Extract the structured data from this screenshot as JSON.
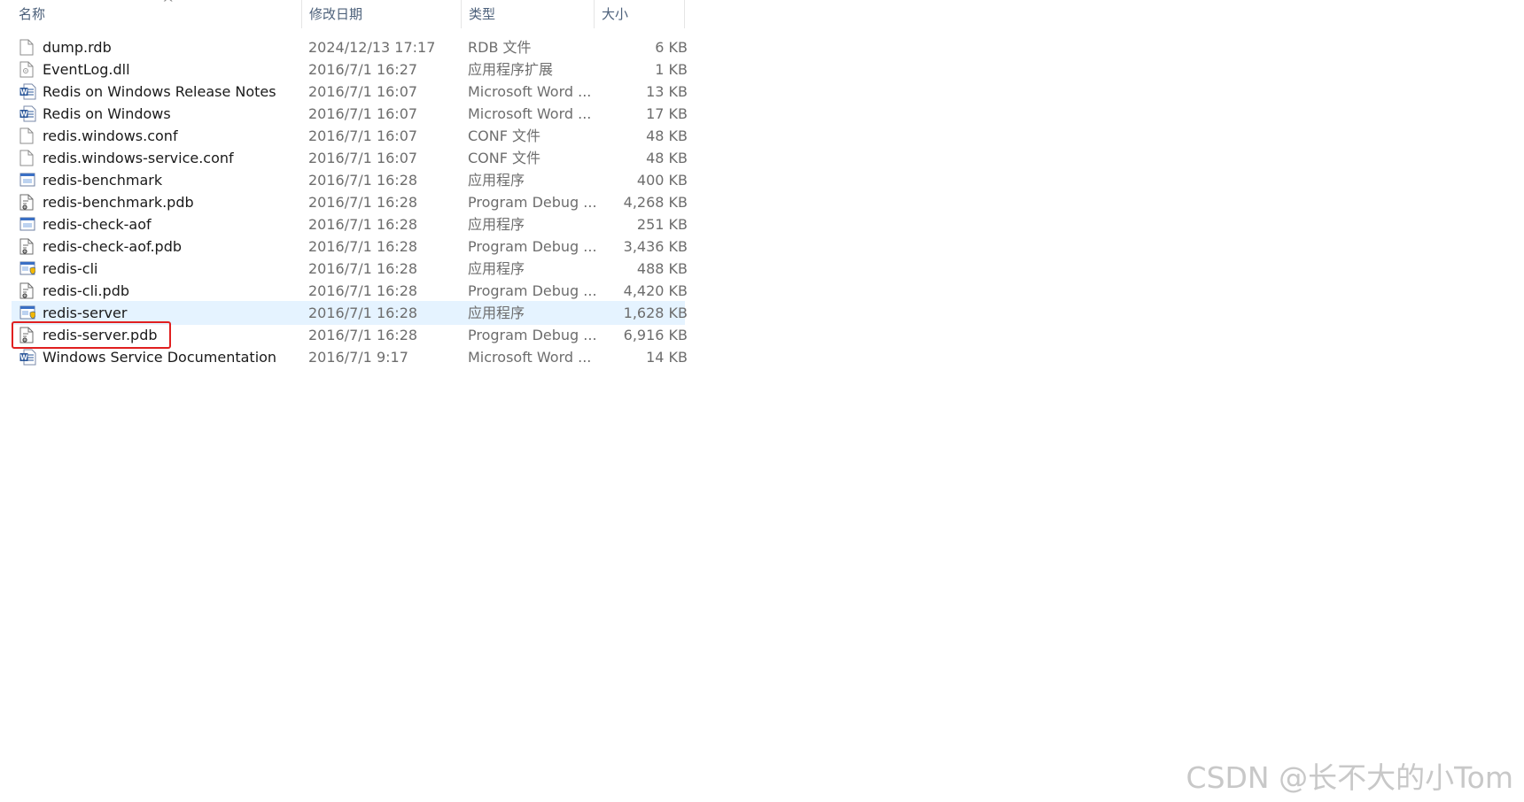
{
  "columns": {
    "name": "名称",
    "date": "修改日期",
    "type": "类型",
    "size": "大小"
  },
  "files": [
    {
      "name": "dump.rdb",
      "date": "2024/12/13 17:17",
      "type": "RDB 文件",
      "size": "6 KB",
      "icon": "blank-file-icon"
    },
    {
      "name": "EventLog.dll",
      "date": "2016/7/1 16:27",
      "type": "应用程序扩展",
      "size": "1 KB",
      "icon": "dll-file-icon"
    },
    {
      "name": "Redis on Windows Release Notes",
      "date": "2016/7/1 16:07",
      "type": "Microsoft Word ...",
      "size": "13 KB",
      "icon": "word-doc-icon"
    },
    {
      "name": "Redis on Windows",
      "date": "2016/7/1 16:07",
      "type": "Microsoft Word ...",
      "size": "17 KB",
      "icon": "word-doc-icon"
    },
    {
      "name": "redis.windows.conf",
      "date": "2016/7/1 16:07",
      "type": "CONF 文件",
      "size": "48 KB",
      "icon": "blank-file-icon"
    },
    {
      "name": "redis.windows-service.conf",
      "date": "2016/7/1 16:07",
      "type": "CONF 文件",
      "size": "48 KB",
      "icon": "blank-file-icon"
    },
    {
      "name": "redis-benchmark",
      "date": "2016/7/1 16:28",
      "type": "应用程序",
      "size": "400 KB",
      "icon": "exe-app-icon"
    },
    {
      "name": "redis-benchmark.pdb",
      "date": "2016/7/1 16:28",
      "type": "Program Debug ...",
      "size": "4,268 KB",
      "icon": "pdb-file-icon"
    },
    {
      "name": "redis-check-aof",
      "date": "2016/7/1 16:28",
      "type": "应用程序",
      "size": "251 KB",
      "icon": "exe-app-icon"
    },
    {
      "name": "redis-check-aof.pdb",
      "date": "2016/7/1 16:28",
      "type": "Program Debug ...",
      "size": "3,436 KB",
      "icon": "pdb-file-icon"
    },
    {
      "name": "redis-cli",
      "date": "2016/7/1 16:28",
      "type": "应用程序",
      "size": "488 KB",
      "icon": "exe-shield-icon"
    },
    {
      "name": "redis-cli.pdb",
      "date": "2016/7/1 16:28",
      "type": "Program Debug ...",
      "size": "4,420 KB",
      "icon": "pdb-file-icon"
    },
    {
      "name": "redis-server",
      "date": "2016/7/1 16:28",
      "type": "应用程序",
      "size": "1,628 KB",
      "icon": "exe-shield-icon",
      "selected": true
    },
    {
      "name": "redis-server.pdb",
      "date": "2016/7/1 16:28",
      "type": "Program Debug ...",
      "size": "6,916 KB",
      "icon": "pdb-file-icon"
    },
    {
      "name": "Windows Service Documentation",
      "date": "2016/7/1 9:17",
      "type": "Microsoft Word ...",
      "size": "14 KB",
      "icon": "word-doc-icon"
    }
  ],
  "watermark": "CSDN @长不大的小Tom",
  "colors": {
    "selected_row": "#e5f3ff",
    "highlight_box": "#e02020",
    "word_blue": "#2b579a"
  }
}
